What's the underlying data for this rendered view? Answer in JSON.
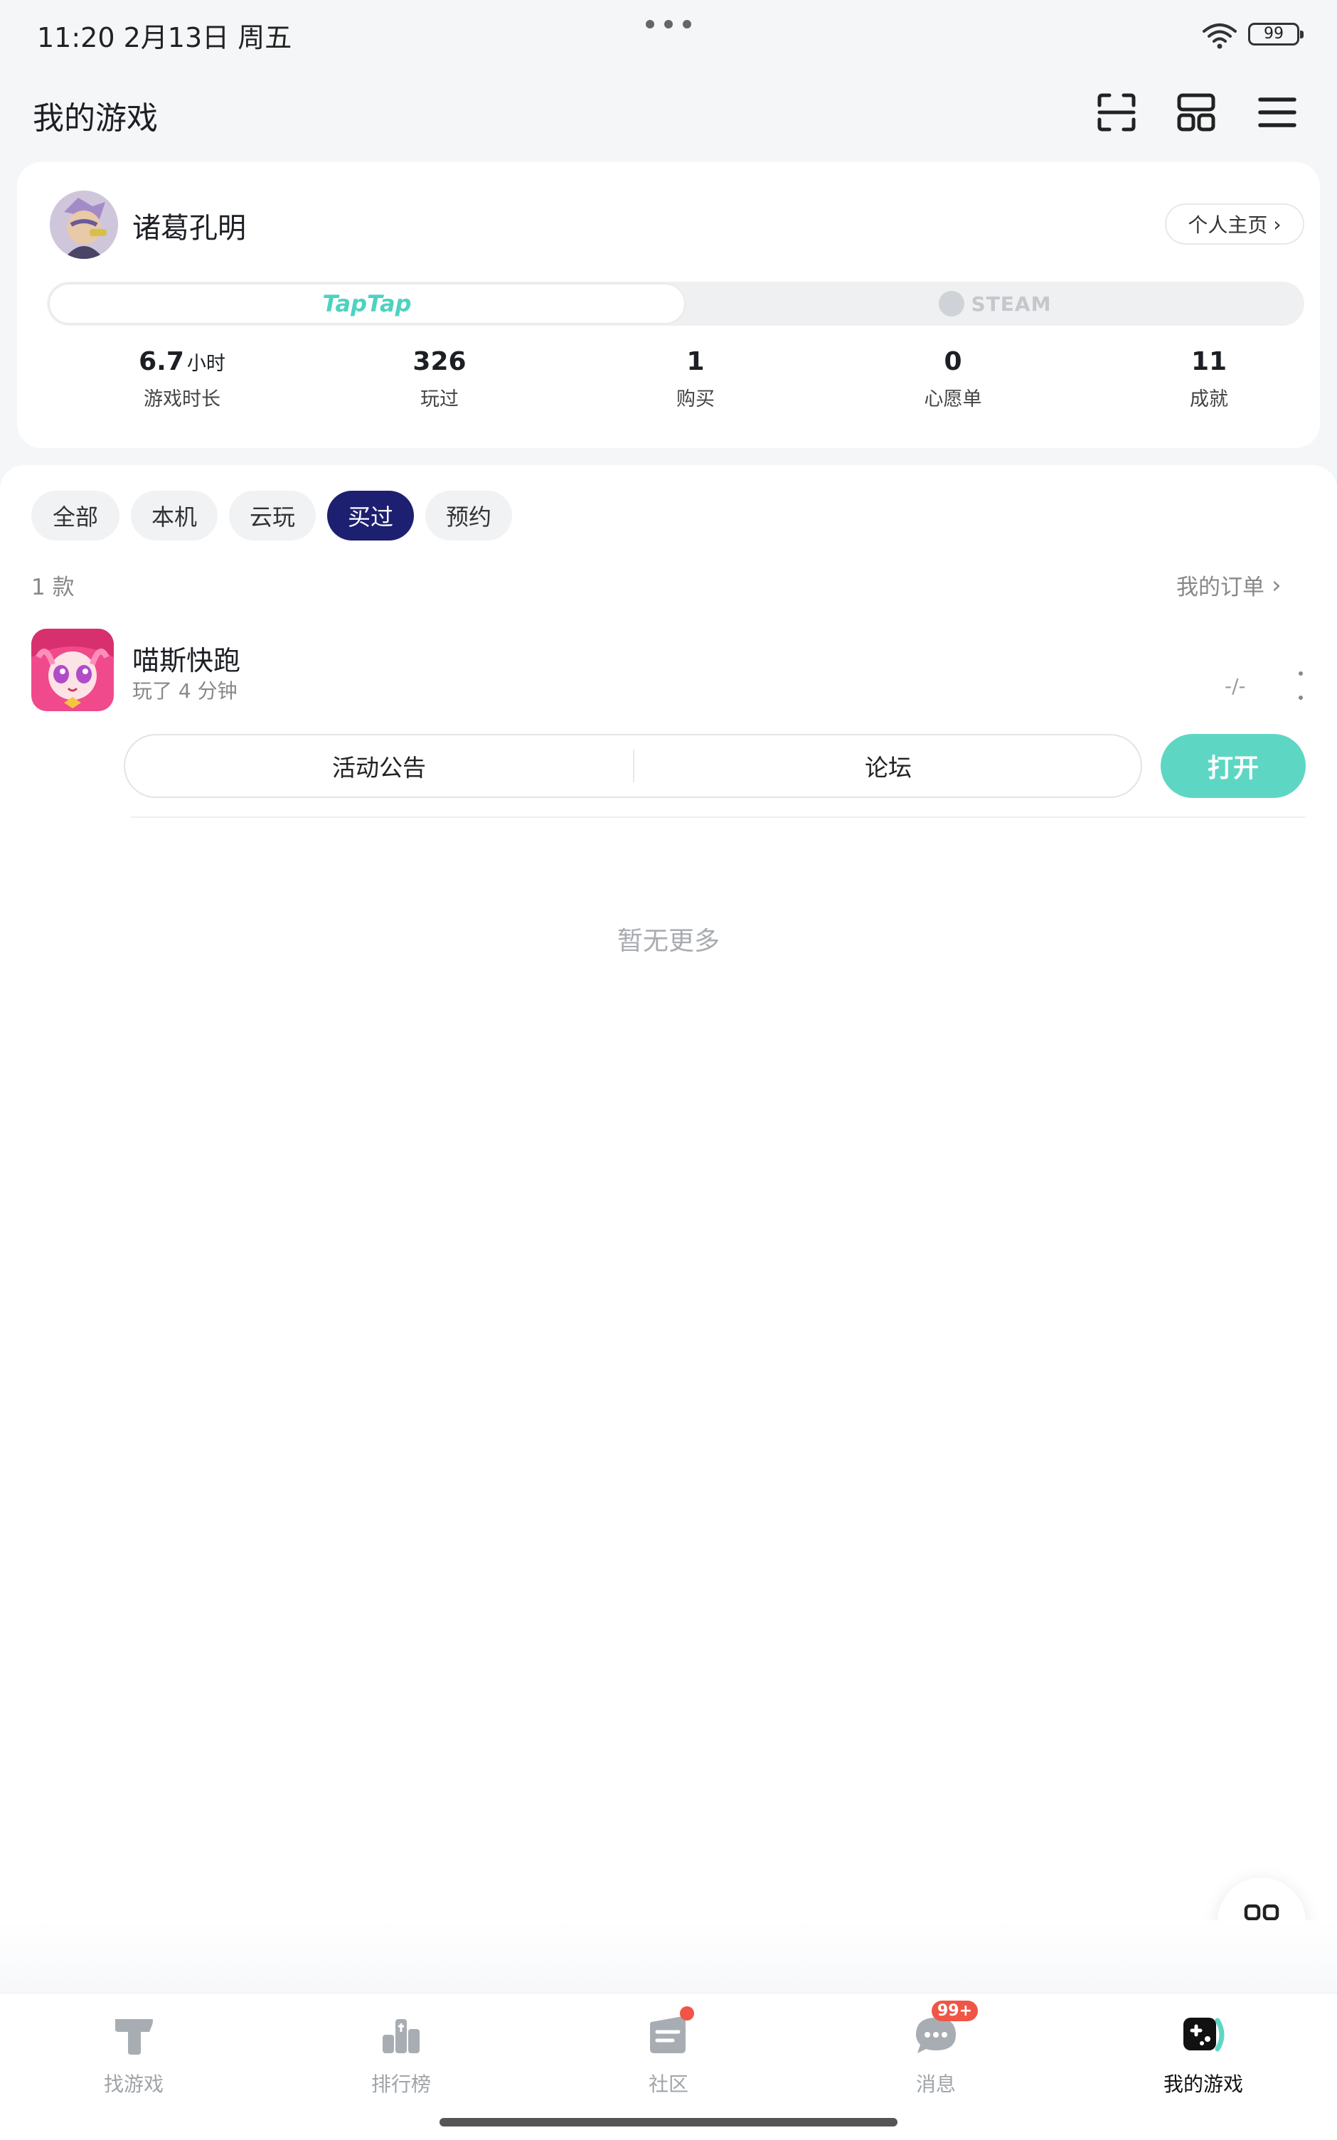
{
  "status_bar": {
    "time_date": "11:20   2月13日 周五",
    "battery": "99"
  },
  "header": {
    "title": "我的游戏",
    "icons": [
      "scan-icon",
      "grid-layout-icon",
      "menu-icon"
    ]
  },
  "profile": {
    "username": "诸葛孔明",
    "profile_button": "个人主页",
    "platforms": [
      "TapTap",
      "STEAM"
    ],
    "stats": [
      {
        "value": "6.7",
        "unit": "小时",
        "label": "游戏时长"
      },
      {
        "value": "326",
        "unit": "",
        "label": "玩过"
      },
      {
        "value": "1",
        "unit": "",
        "label": "购买"
      },
      {
        "value": "0",
        "unit": "",
        "label": "心愿单"
      },
      {
        "value": "11",
        "unit": "",
        "label": "成就"
      }
    ]
  },
  "filters": [
    "全部",
    "本机",
    "云玩",
    "买过",
    "预约"
  ],
  "active_filter": "买过",
  "list": {
    "count": "1 款",
    "orders_link": "我的订单"
  },
  "game": {
    "name": "喵斯快跑",
    "playtime": "玩了 4 分钟",
    "rating": "-/-",
    "actions": [
      "活动公告",
      "论坛"
    ],
    "open_button": "打开"
  },
  "empty_text": "暂无更多",
  "bottom_nav": [
    {
      "label": "找游戏",
      "icon": "taptap-icon"
    },
    {
      "label": "排行榜",
      "icon": "ranking-icon"
    },
    {
      "label": "社区",
      "icon": "community-icon"
    },
    {
      "label": "消息",
      "icon": "message-icon",
      "badge": "99+"
    },
    {
      "label": "我的游戏",
      "icon": "my-games-icon",
      "active": true
    }
  ],
  "colors": {
    "accent_teal": "#5ed6c4",
    "active_chip": "#1d1f70",
    "badge_red": "#f05545"
  }
}
